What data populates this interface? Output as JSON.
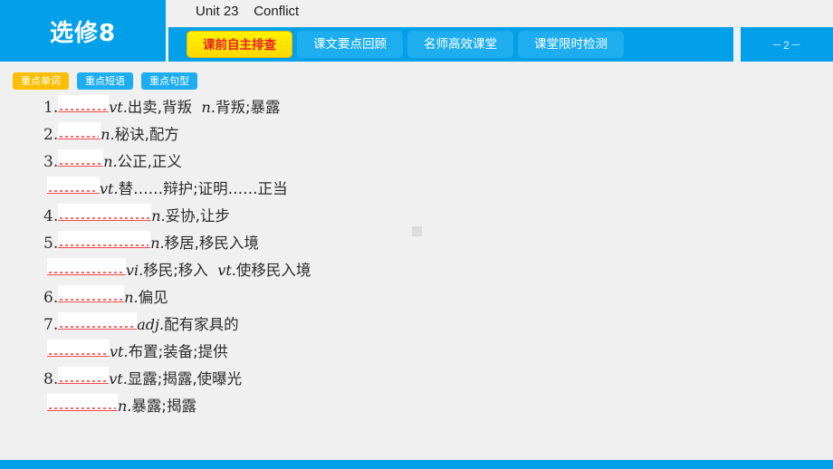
{
  "header": {
    "brand": "选修8",
    "unit_title": "Unit 23    Conflict",
    "page_number": "－2－",
    "tabs": [
      {
        "label": "课前自主排查",
        "active": true
      },
      {
        "label": "课文要点回顾",
        "active": false
      },
      {
        "label": "名师高效课堂",
        "active": false
      },
      {
        "label": "课堂限时检测",
        "active": false
      }
    ]
  },
  "subtabs": [
    {
      "label": "重点单词",
      "active": true
    },
    {
      "label": "重点短语",
      "active": false
    },
    {
      "label": "重点句型",
      "active": false
    }
  ],
  "content": {
    "lines": [
      {
        "num": "1.",
        "blank_width": 56,
        "text": "vt.出卖,背叛  n.背叛;暴露",
        "pos": "vt.",
        "def": "出卖,背叛  ",
        "pos2": "n.",
        "def2": "背叛;暴露",
        "indent": false
      },
      {
        "num": "2.",
        "blank_width": 47,
        "text": "n.秘诀,配方",
        "pos": "n.",
        "def": "秘诀,配方",
        "pos2": "",
        "def2": "",
        "indent": false
      },
      {
        "num": "3.",
        "blank_width": 50,
        "text": "n.公正,正义",
        "pos": "n.",
        "def": "公正,正义",
        "pos2": "",
        "def2": "",
        "indent": false
      },
      {
        "num": "",
        "blank_width": 58,
        "text": "vt.替……辩护;证明……正当",
        "pos": "vt.",
        "def": "替……辩护;证明……正当",
        "pos2": "",
        "def2": "",
        "indent": true
      },
      {
        "num": "4.",
        "blank_width": 103,
        "text": "n.妥协,让步",
        "pos": "n.",
        "def": "妥协,让步",
        "pos2": "",
        "def2": "",
        "indent": false
      },
      {
        "num": "5.",
        "blank_width": 102,
        "text": "n.移居,移民入境",
        "pos": "n.",
        "def": "移居,移民入境",
        "pos2": "",
        "def2": "",
        "indent": false
      },
      {
        "num": "",
        "blank_width": 87,
        "text": "vi.移民;移入  vt.使移民入境",
        "pos": "vi.",
        "def": "移民;移入  ",
        "pos2": "vt.",
        "def2": "使移民入境",
        "indent": true
      },
      {
        "num": "6.",
        "blank_width": 73,
        "text": "n.偏见",
        "pos": "n.",
        "def": "偏见",
        "pos2": "",
        "def2": "",
        "indent": false
      },
      {
        "num": "7.",
        "blank_width": 87,
        "text": "adj.配有家具的",
        "pos": "adj.",
        "def": "配有家具的",
        "pos2": "",
        "def2": "",
        "indent": false
      },
      {
        "num": "",
        "blank_width": 69,
        "text": "vt.布置;装备;提供",
        "pos": "vt.",
        "def": "布置;装备;提供",
        "pos2": "",
        "def2": "",
        "indent": true
      },
      {
        "num": "8.",
        "blank_width": 56,
        "text": "vt.显露;揭露,使曝光",
        "pos": "vt.",
        "def": "显露;揭露,使曝光",
        "pos2": "",
        "def2": "",
        "indent": false
      },
      {
        "num": "",
        "blank_width": 78,
        "text": "n.暴露;揭露",
        "pos": "n.",
        "def": "暴露;揭露",
        "pos2": "",
        "def2": "",
        "indent": true
      }
    ]
  },
  "colors": {
    "brand_blue": "#02a0e8",
    "tab_blue": "#1eaef0",
    "active_tab_yellow": "#ffe600",
    "active_tab_text_red": "#e8212b",
    "subtab_active_amber": "#fbbf00",
    "page_background": "#f0f0f0",
    "blank_underline_red": "#f04a4a"
  }
}
